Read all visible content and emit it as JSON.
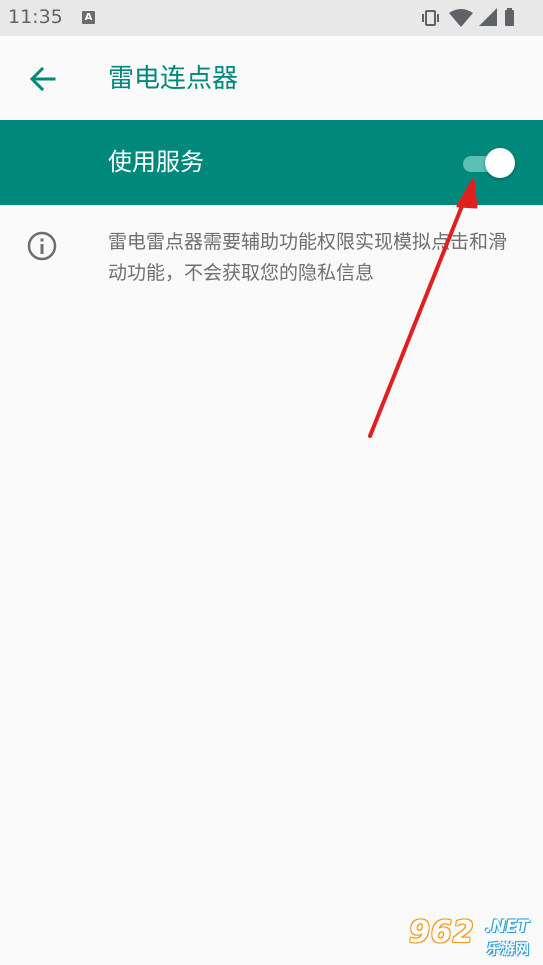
{
  "status_bar": {
    "time": "11:35",
    "notification_icon": "A",
    "icons": [
      "vibrate-icon",
      "wifi-icon",
      "cellular-signal-icon",
      "battery-icon"
    ]
  },
  "app_bar": {
    "back_icon": "arrow-back-icon",
    "title": "雷电连点器"
  },
  "service": {
    "label": "使用服务",
    "enabled": true
  },
  "info": {
    "icon": "info-icon",
    "text": "雷电雷点器需要辅助功能权限实现模拟点击和滑动功能，不会获取您的隐私信息"
  },
  "watermark": {
    "digits": "962",
    "domain": ".NET",
    "subtitle": "乐游网"
  },
  "colors": {
    "accent": "#00897b",
    "switch_track": "#5bbfb2",
    "arrow": "#e02020",
    "background": "#fafafa"
  }
}
